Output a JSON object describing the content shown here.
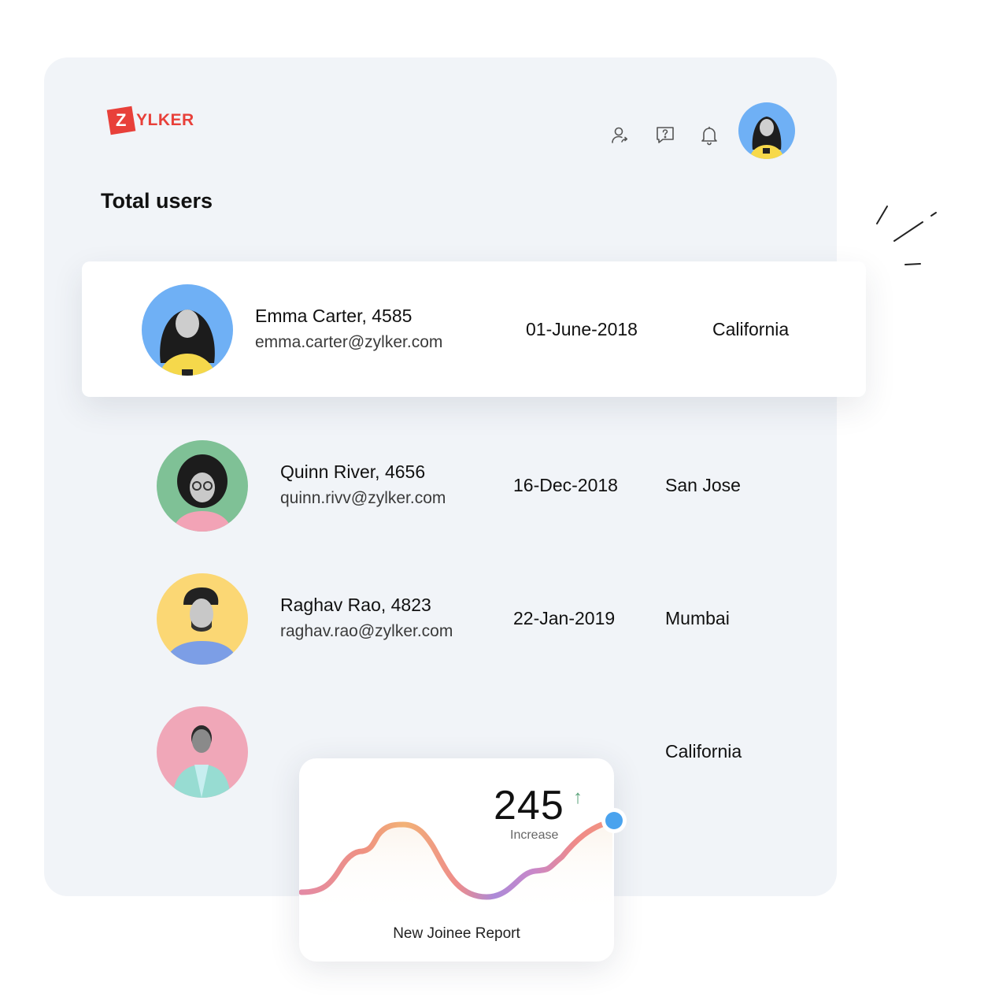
{
  "brand": {
    "logo_letter": "Z",
    "logo_rest": "YLKER",
    "color": "#e8403a"
  },
  "header": {
    "icons": [
      "user-switch-icon",
      "help-chat-icon",
      "bell-icon"
    ],
    "profile_avatar": "profile-avatar"
  },
  "page": {
    "title": "Total users"
  },
  "users": [
    {
      "name": "Emma Carter, 4585",
      "email": "emma.carter@zylker.com",
      "date": "01-June-2018",
      "city": "California",
      "avatar_bg": "#6fb0f5",
      "highlighted": true
    },
    {
      "name": "Quinn River, 4656",
      "email": "quinn.rivv@zylker.com",
      "date": "16-Dec-2018",
      "city": "San Jose",
      "avatar_bg": "#7fc196"
    },
    {
      "name": "Raghav Rao, 4823",
      "email": "raghav.rao@zylker.com",
      "date": "22-Jan-2019",
      "city": "Mumbai",
      "avatar_bg": "#fbd774"
    },
    {
      "name": "",
      "email": "",
      "date": "",
      "city": "California",
      "avatar_bg": "#f0a7b8"
    }
  ],
  "report": {
    "value": "245",
    "trend": "↑",
    "trend_label": "Increase",
    "title": "New Joinee Report",
    "marker_color": "#4aa3ee"
  }
}
